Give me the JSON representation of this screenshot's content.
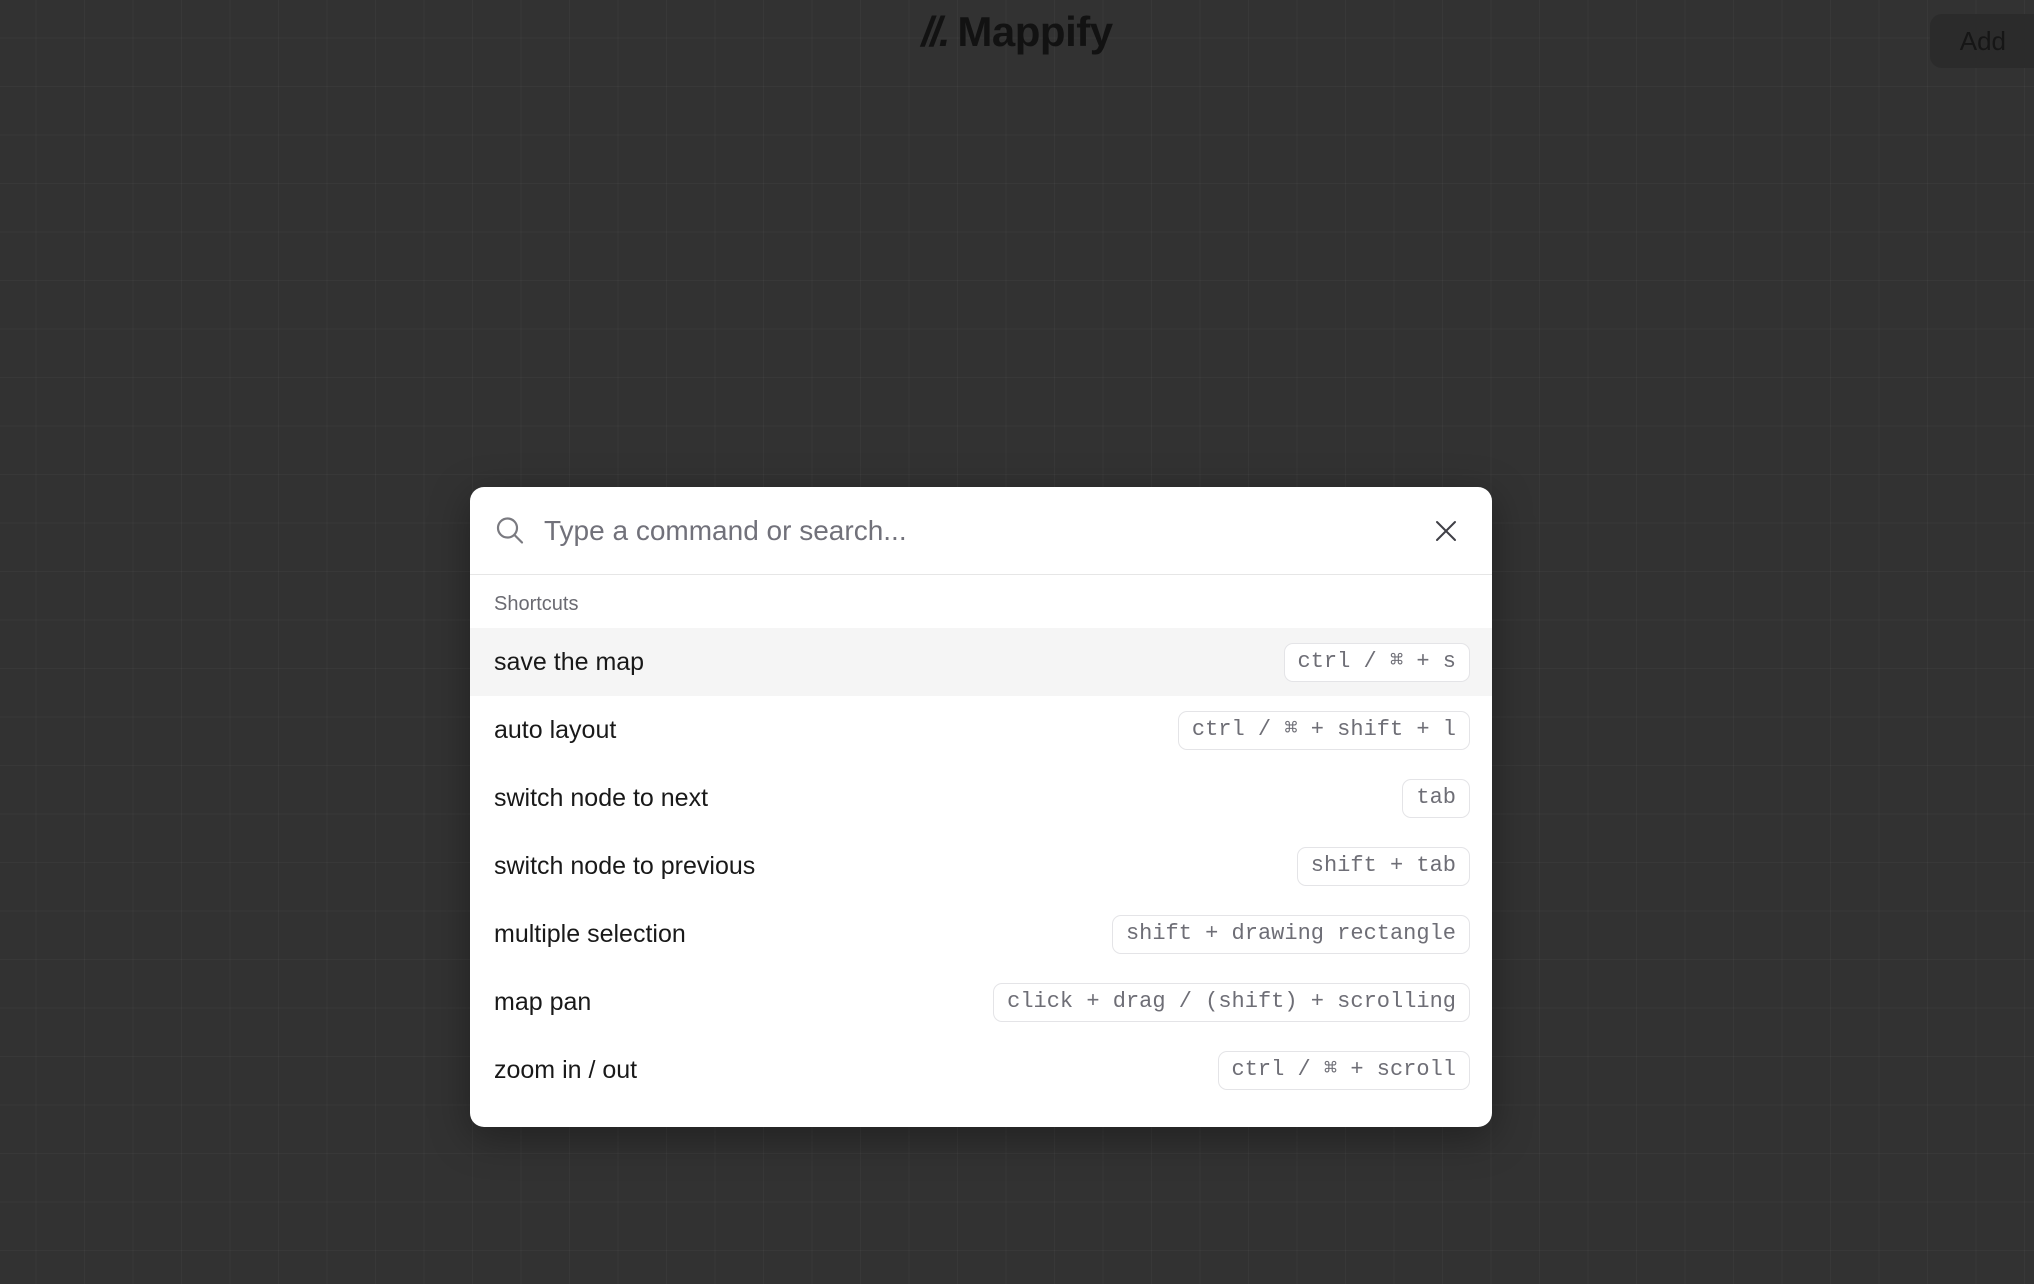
{
  "app": {
    "logo_mark": "//.",
    "logo_text": "Mappify",
    "background_color": "#323232",
    "grid_color": "#3a3a3a"
  },
  "topbar": {
    "add_button_label": "Add"
  },
  "palette": {
    "search": {
      "placeholder": "Type a command or search...",
      "value": "",
      "icon": "search-icon"
    },
    "close_icon": "close-icon",
    "group_label": "Shortcuts",
    "selected_index": 0,
    "selected_color": "#f5f5f5",
    "shortcuts": [
      {
        "label": "save the map",
        "keys": "ctrl / ⌘ + s"
      },
      {
        "label": "auto layout",
        "keys": "ctrl / ⌘ + shift + l"
      },
      {
        "label": "switch node to next",
        "keys": "tab"
      },
      {
        "label": "switch node to previous",
        "keys": "shift + tab"
      },
      {
        "label": "multiple selection",
        "keys": "shift + drawing rectangle"
      },
      {
        "label": "map pan",
        "keys": "click + drag / (shift) + scrolling"
      },
      {
        "label": "zoom in / out",
        "keys": "ctrl / ⌘ + scroll"
      }
    ]
  }
}
